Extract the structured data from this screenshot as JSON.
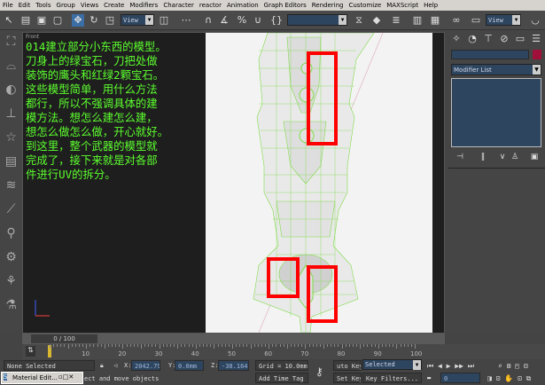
{
  "menu": [
    "File",
    "Edit",
    "Tools",
    "Group",
    "Views",
    "Create",
    "Modifiers",
    "Character",
    "reactor",
    "Animation",
    "Graph Editors",
    "Rendering",
    "Customize",
    "MAXScript",
    "Help"
  ],
  "toolbar": {
    "view_dropdown": "View",
    "view_dropdown_2": "View",
    "named_selection": ""
  },
  "viewport": {
    "label": "Front",
    "note": "014建立部分小东西的模型。\n刀身上的绿宝石，刀把处做\n装饰的鹰头和红绿2颗宝石。\n这些模型简单，用什么方法\n都行，所以不强调具体的建\n模方法。想怎么建怎么建，\n想怎么做怎么做，开心就好。\n到这里，整个武器的模型就\n完成了，接下来就是对各部\n件进行UV的拆分。"
  },
  "command_panel": {
    "object_name": "",
    "object_color": "#a0103a",
    "modifier_list": "Modifier List"
  },
  "timeline": {
    "frame": "0 / 100",
    "ticks": [
      "0",
      "10",
      "20",
      "30",
      "40",
      "50",
      "60",
      "70",
      "80",
      "90",
      "100"
    ]
  },
  "status": {
    "selection": "None Selected",
    "prompt": "ect and move objects",
    "x_label": "X:",
    "x": "2042.79",
    "y_label": "Y:",
    "y": "0.0mm",
    "z_label": "Z:",
    "z": "-38.164",
    "grid": "Grid = 10.0mm",
    "add_time_tag": "Add Time Tag",
    "auto_key": "uto Key",
    "selected": "Selected",
    "set_key": "Set Key",
    "key_filters": "Key Filters...",
    "frame_field": "0"
  },
  "taskbar": {
    "material_editor": "Material Edit..."
  },
  "colors": {
    "highlight": "#ff0000",
    "wire": "#7fdc4a",
    "note_text": "#5cff2e"
  }
}
